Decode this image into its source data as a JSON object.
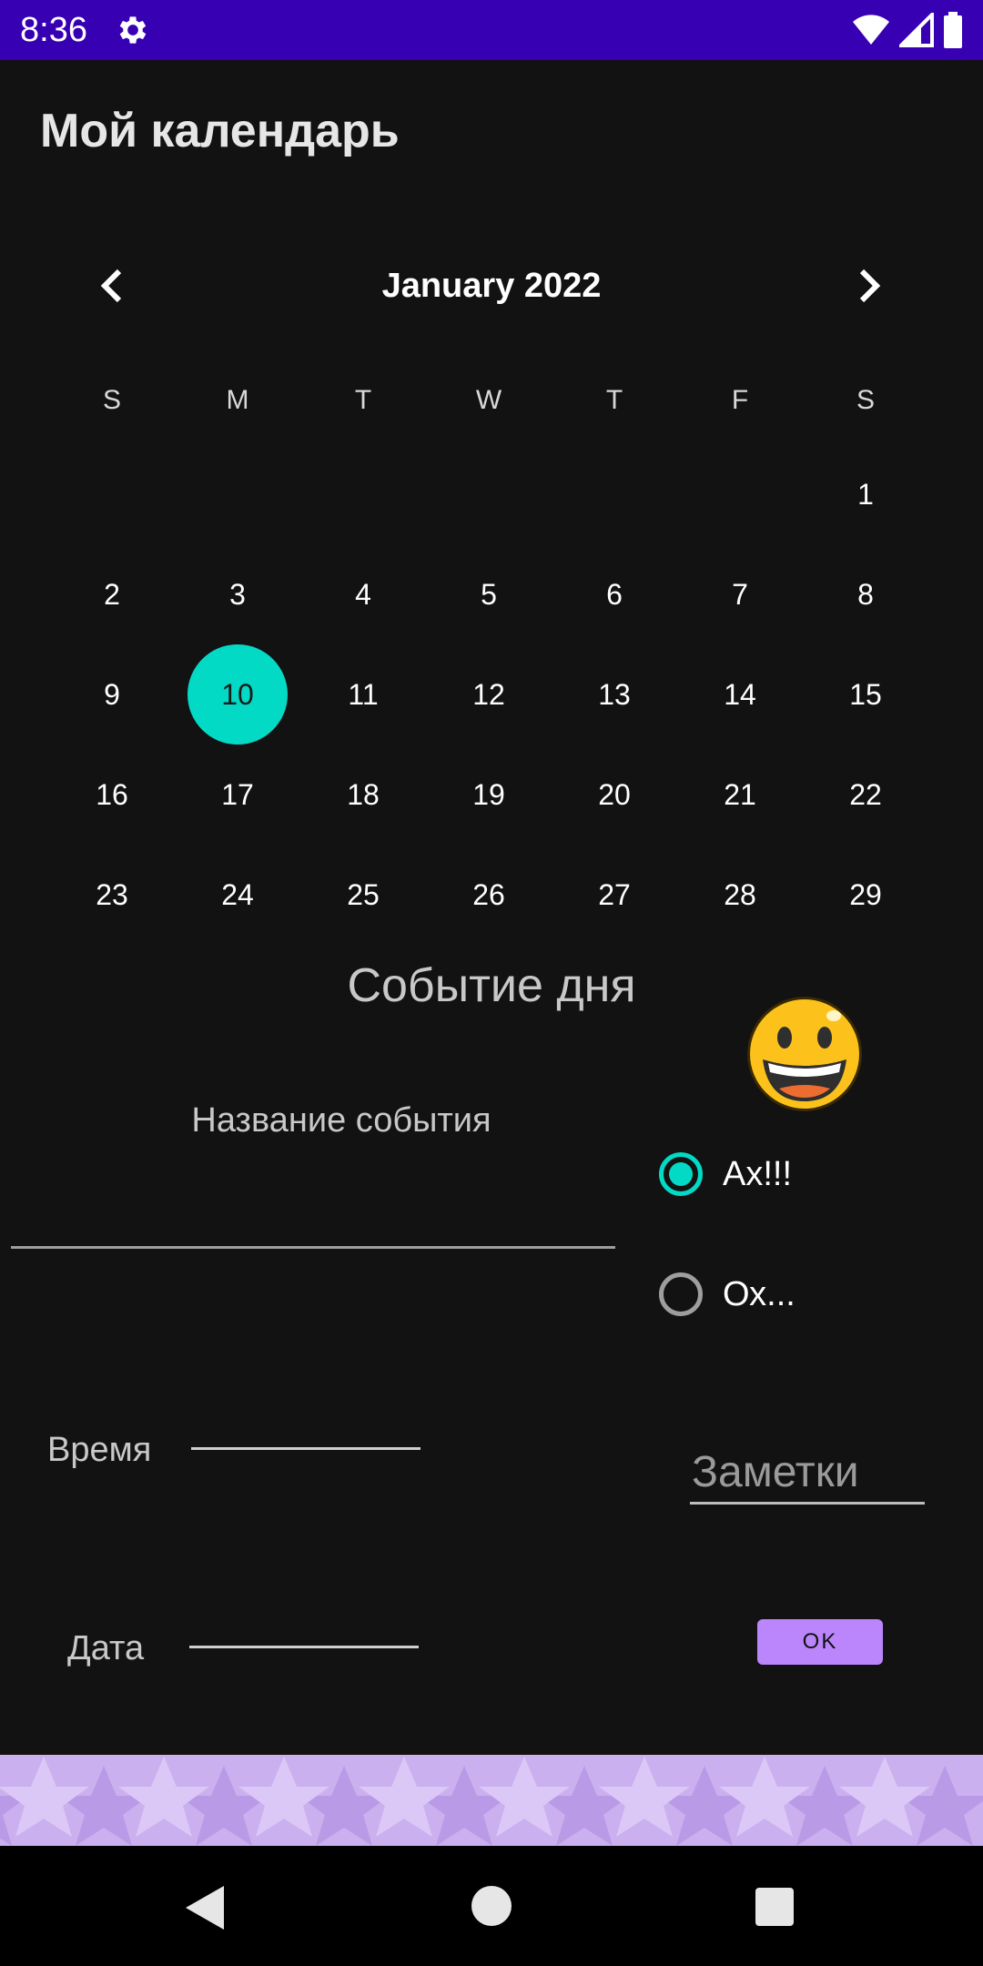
{
  "status_bar": {
    "time": "8:36",
    "background": "#3700b3"
  },
  "app": {
    "title": "Мой календарь"
  },
  "calendar": {
    "month_label": "January 2022",
    "weekdays": [
      "S",
      "M",
      "T",
      "W",
      "T",
      "F",
      "S"
    ],
    "days": [
      "1",
      "2",
      "3",
      "4",
      "5",
      "6",
      "7",
      "8",
      "9",
      "10",
      "11",
      "12",
      "13",
      "14",
      "15",
      "16",
      "17",
      "18",
      "19",
      "20",
      "21",
      "22",
      "23",
      "24",
      "25",
      "26",
      "27",
      "28",
      "29"
    ],
    "first_weekday_index": 6,
    "selected_day": "10",
    "accent": "#03dac5"
  },
  "event": {
    "heading": "Событие дня",
    "name_label": "Название события",
    "radio_options": [
      {
        "label": "Ах!!!",
        "checked": true
      },
      {
        "label": "Ох...",
        "checked": false
      }
    ],
    "time_label": "Время",
    "date_label": "Дата",
    "notes_placeholder": "Заметки",
    "ok_label": "OK",
    "ok_color": "#bb86fc"
  },
  "icons": {
    "status": [
      "gear-icon",
      "wifi-icon",
      "signal-icon",
      "battery-icon"
    ],
    "calendar": [
      "chevron-left-icon",
      "chevron-right-icon"
    ],
    "emoji": "grinning-face-icon",
    "nav": [
      "back-icon",
      "home-icon",
      "recent-apps-icon"
    ]
  }
}
